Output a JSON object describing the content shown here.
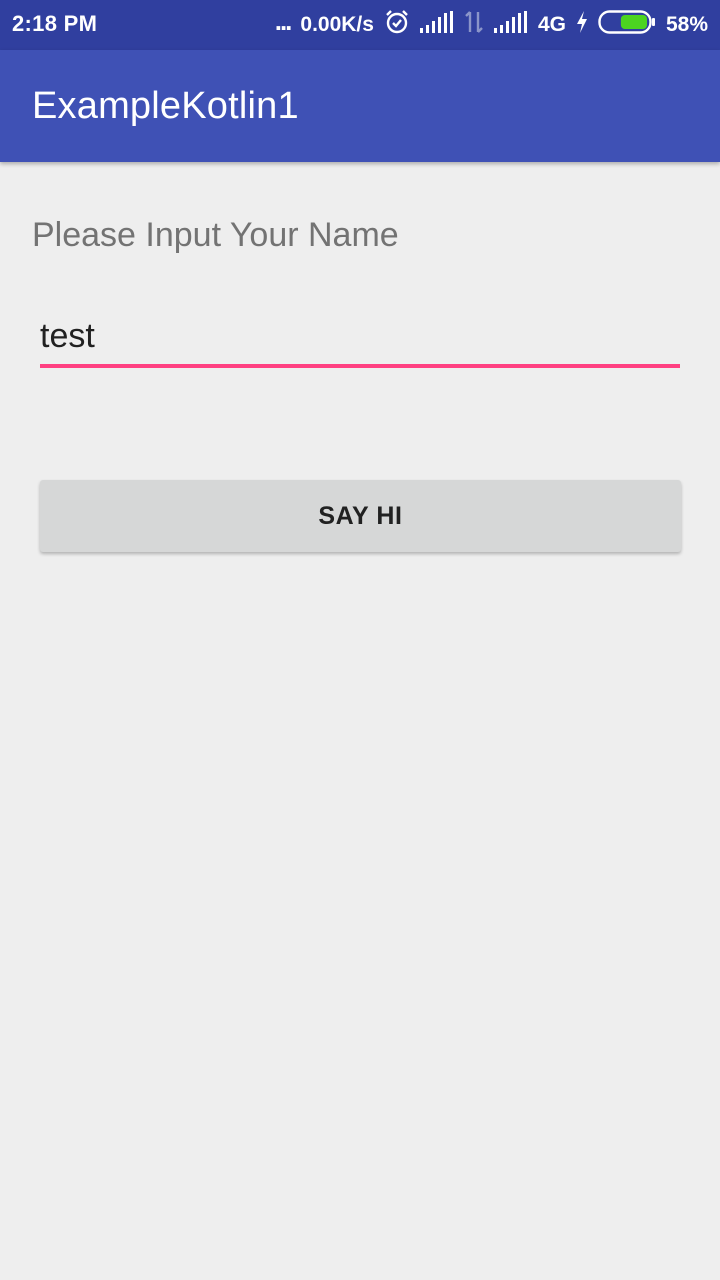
{
  "status_bar": {
    "time": "2:18 PM",
    "more_dots": "...",
    "network_speed": "0.00K/s",
    "network_type": "4G",
    "battery_percent": "58%",
    "battery_level": 0.58,
    "icons": [
      "alarm-icon",
      "signal-icon",
      "data-transfer-icon",
      "signal-icon",
      "charging-icon",
      "battery-icon"
    ]
  },
  "app_bar": {
    "title": "ExampleKotlin1",
    "color": "#3f51b5"
  },
  "main": {
    "prompt_label": "Please Input Your Name",
    "name_input": {
      "value": "test",
      "accent_color": "#ff4081"
    },
    "say_hi_button": {
      "label": "SAY HI"
    }
  }
}
